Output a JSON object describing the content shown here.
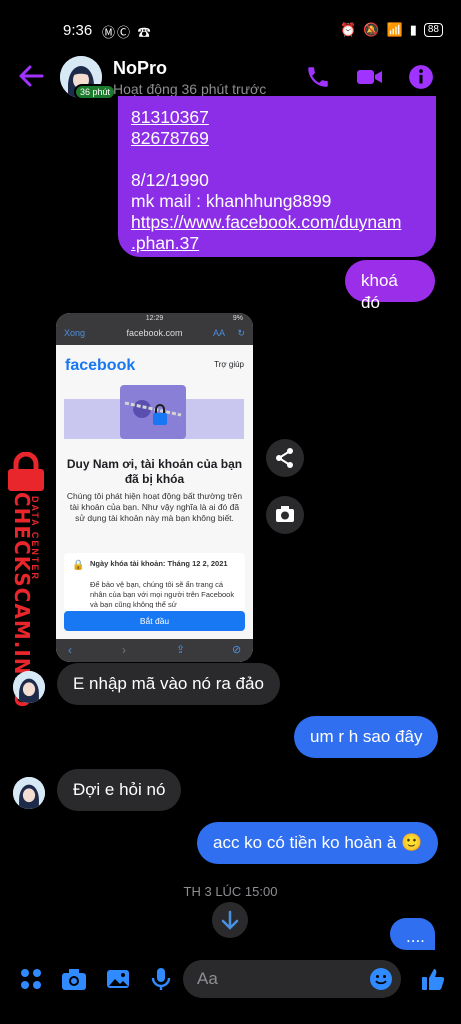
{
  "status_bar": {
    "time": "9:36",
    "battery": "88",
    "left_icons": "ⓂⒸ ☎"
  },
  "header": {
    "contact_name": "NoPro",
    "activity": "Hoạt động 36 phút trước",
    "badge": "36 phút"
  },
  "messages": {
    "sent_block": {
      "line1": "81310367",
      "line2": "82678769",
      "line3": "8/12/1990",
      "line4": "mk mail : khanhhung8899",
      "line5": "https://www.facebook.com/duynam",
      "line6": ".phan.37"
    },
    "sent_lock": "khoá đó",
    "recv_1": "E nhập mã vào nó ra đảo",
    "sent_2": "um r h sao đây",
    "recv_2": "Đợi e hỏi nó",
    "sent_3": "acc ko có tiền ko hoàn à 🙂",
    "timestamp": "TH 3 LÚC 15:00",
    "sent_4": "...."
  },
  "screenshot": {
    "status_time": "12:29",
    "status_battery": "9%",
    "done": "Xong",
    "url": "facebook.com",
    "aa": "AA",
    "brand": "facebook",
    "help": "Trợ giúp",
    "heading": "Duy Nam ơi, tài khoản của bạn đã bị khóa",
    "paragraph": "Chúng tôi phát hiện hoạt động bất thường trên tài khoản của bạn. Như vậy nghĩa là ai đó đã sử dụng tài khoản này mà bạn không biết.",
    "card_title": "Ngày khóa tài khoản: Tháng 12 2, 2021",
    "card_body": "Để bảo vệ bạn, chúng tôi sẽ ẩn trang cá nhân của bạn với mọi người trên Facebook và bạn cũng không thể sử",
    "button": "Bắt đầu"
  },
  "watermark": {
    "big": "CHECKSCAM.INFO",
    "small": "DATA CENTER"
  },
  "composer": {
    "placeholder": "Aa"
  },
  "colors": {
    "sent_purple": "#9b2ee8",
    "sent_blue": "#2f6ff0",
    "received": "#2a2a2c",
    "accent": "#a033ff"
  }
}
